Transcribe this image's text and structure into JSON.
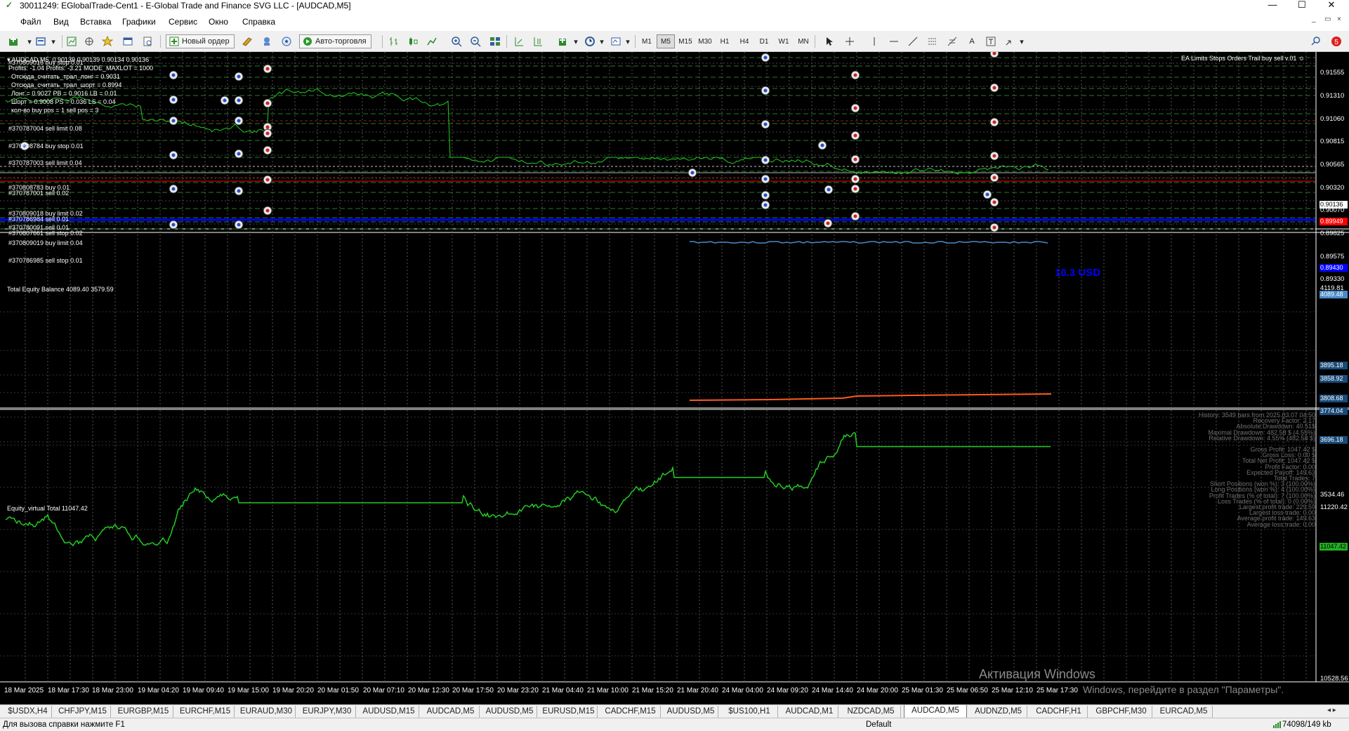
{
  "window": {
    "title": "30011249: EGlobalTrade-Cent1 - E-Global Trade and Finance SVG LLC - [AUDCAD,M5]",
    "controls": [
      "—",
      "☐",
      "✕"
    ],
    "mdi_controls": [
      "_",
      "▭",
      "×"
    ]
  },
  "menu": [
    {
      "label": "Файл",
      "u": "Ф"
    },
    {
      "label": "Вид",
      "u": "В"
    },
    {
      "label": "Вставка",
      "u": "с"
    },
    {
      "label": "Графики",
      "u": "Г"
    },
    {
      "label": "Сервис",
      "u": "С"
    },
    {
      "label": "Окно",
      "u": "О"
    },
    {
      "label": "Справка",
      "u": "п"
    }
  ],
  "toolbar": {
    "new_order": "Новый ордер",
    "auto_trading": "Авто-торговля",
    "timeframes": [
      "M1",
      "M5",
      "M15",
      "M30",
      "H1",
      "H4",
      "D1",
      "W1",
      "MN"
    ],
    "active_timeframe": "M5",
    "notification_count": "5"
  },
  "chart": {
    "main_header": "AUDCAD,M5  0.90139 0.90139 0.90134 0.90136",
    "info_lines": [
      "Profits: -1.04 Profits: -3.21 MODE_MAXLOT = 1000",
      "Отсюда_считать_трал_лонг = 0.9031",
      "Отсюда_считать_трал_шорт = 0.8994",
      "Лонг = 0.9027 PB = 0.9016 LB = 0.01",
      "Шорт = 0.9008 PS = 0.036 LS = 0.04",
      "кол-во buy pos = 1 sell pos = 3"
    ],
    "order_labels": [
      "#370809016 buy stop 0.01",
      "#370787004 sell limit 0.08",
      "#370808784 buy stop 0.01",
      "#370787003 sell limit 0.04",
      "#370808783 buy 0.01",
      "#370787001 sell 0.02",
      "#370809018 buy limit 0.02",
      "#370786984 sell 0.01",
      "#370780091 sell 0.01",
      "#370807661 sell stop 0.02",
      "#370809019 buy limit 0.04",
      "#370786985 sell stop 0.01"
    ],
    "ea_label": "EA Limits Stops Orders Trail buy sell v.01",
    "usd_label": "10.3 USD",
    "price_axis": [
      "0.91555",
      "0.91310",
      "0.91060",
      "0.90815",
      "0.90565",
      "0.90320",
      "0.90070",
      "0.89825",
      "0.89575",
      "0.89330"
    ],
    "price_tags": [
      {
        "text": "0.90136",
        "bg": "#ffffff",
        "fg": "#000000"
      },
      {
        "text": "0.89949",
        "bg": "#ff0000",
        "fg": "#ffffff"
      },
      {
        "text": "0.89430",
        "bg": "#0000ff",
        "fg": "#ffffff"
      }
    ],
    "equity_header": "Total Equity Balance 4089.40 3579.59",
    "equity_axis_top": "4119.81",
    "equity_axis_bottom": "3534.46",
    "equity_tags": [
      "4089.48",
      "3895.18",
      "3858.92",
      "3808.68",
      "3774.04",
      "3696.18"
    ],
    "virtual_header": "Equity_virtual Total 11047.42",
    "virtual_axis_top": "11220.42",
    "virtual_axis_bottom": "10528.56",
    "virtual_tag": "11047.42",
    "stats": [
      "History: 3549 bars from 2025.03.07 04:50",
      "Recovery Factor: 2.17",
      "Absolute Drawdown: 40.51$",
      "Maximal Drawdown: 482.58 $ (4.55%)",
      "Relative Drawdown: 4.55% (482.58 $)",
      "Gross Profit: 1047.42 $",
      "Gross Loss: 0.00 $",
      "Total Net Profit: 1047.42 $",
      "Profit Factor: 0.00",
      "Expected Payoff: 149.63",
      "Total Trades: 7",
      "Short Positions (won %): 3 (100.00%)",
      "Long Positions (won %): 4 (100.00%)",
      "Profit Trades (% of total): 7 (100.00%)",
      "Loss Trades (% of total): 0 (0.00%)",
      "Largest profit trade: 229.59",
      "Largest loss trade: 0.00",
      "Average profit trade: 149.63",
      "Average loss trade: 0.00"
    ],
    "time_axis": [
      "18 Mar 2025",
      "18 Mar 17:30",
      "18 Mar 23:00",
      "19 Mar 04:20",
      "19 Mar 09:40",
      "19 Mar 15:00",
      "19 Mar 20:20",
      "20 Mar 01:50",
      "20 Mar 07:10",
      "20 Mar 12:30",
      "20 Mar 17:50",
      "20 Mar 23:20",
      "21 Mar 04:40",
      "21 Mar 10:00",
      "21 Mar 15:20",
      "21 Mar 20:40",
      "24 Mar 04:00",
      "24 Mar 09:20",
      "24 Mar 14:40",
      "24 Mar 20:00",
      "25 Mar 01:30",
      "25 Mar 06:50",
      "25 Mar 12:10",
      "25 Mar 17:30"
    ],
    "activation_title": "Активация Windows",
    "activation_text": "Windows, перейдите в раздел \"Параметры\"."
  },
  "tabs": [
    "$USDX,H4",
    "CHFJPY,M15",
    "EURGBP,M15",
    "EURCHF,M15",
    "EURAUD,M30",
    "EURJPY,M30",
    "AUDUSD,M15",
    "AUDCAD,M5",
    "AUDUSD,M5",
    "EURUSD,M15",
    "CADCHF,M15",
    "AUDUSD,M5",
    "$US100,H1",
    "AUDCAD,M1",
    "NZDCAD,M5",
    "AUDCAD,M5",
    "AUDNZD,M5",
    "CADCHF,H1",
    "GBPCHF,M30",
    "EURCAD,M5"
  ],
  "active_tab_index": 15,
  "status": {
    "help": "Для вызова справки нажмите F1",
    "profile": "Default",
    "traffic": "74098/149 kb"
  }
}
